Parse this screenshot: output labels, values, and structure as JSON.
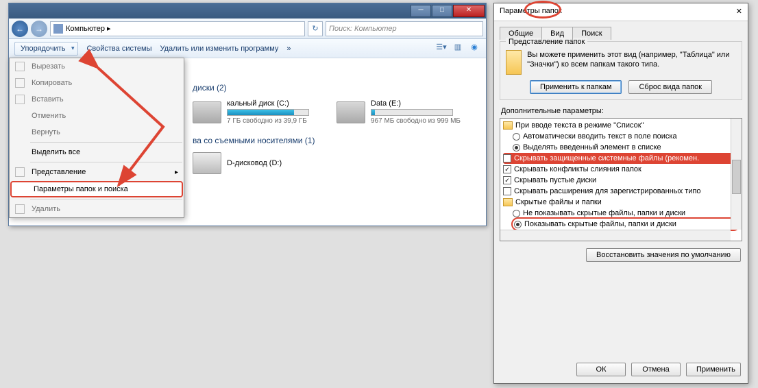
{
  "explorer": {
    "breadcrumb": "Компьютер  ▸",
    "search_placeholder": "Поиск: Компьютер",
    "toolbar": {
      "organize": "Упорядочить",
      "properties": "Свойства системы",
      "uninstall": "Удалить или изменить программу",
      "overflow": "»"
    },
    "menu": {
      "cut": "Вырезать",
      "copy": "Копировать",
      "paste": "Вставить",
      "undo": "Отменить",
      "redo": "Вернуть",
      "select_all": "Выделить все",
      "layout": "Представление",
      "folder_opts": "Параметры папок и поиска",
      "delete": "Удалить"
    },
    "content": {
      "hd_section": "диски (2)",
      "drive_c": {
        "name": "кальный диск (C:)",
        "sub": "7 ГБ свободно из 39,9 ГБ",
        "fill": 82
      },
      "drive_e": {
        "name": "Data (E:)",
        "sub": "967 МБ свободно из 999 МБ",
        "fill": 4
      },
      "removable_section": "ва со съемными носителями (1)",
      "dvd": "D-дисковод (D:)"
    }
  },
  "dialog": {
    "title": "Параметры папок",
    "tabs": {
      "general": "Общие",
      "view": "Вид",
      "search": "Поиск"
    },
    "present": {
      "group": "Представление папок",
      "text": "Вы можете применить этот вид (например, \"Таблица\" или \"Значки\") ко всем папкам такого типа.",
      "apply": "Применить к папкам",
      "reset": "Сброс вида папок"
    },
    "adv_label": "Дополнительные параметры:",
    "tree": {
      "g1": "При вводе текста в режиме \"Список\"",
      "g1a": "Автоматически вводить текст в поле поиска",
      "g1b": "Выделять введенный элемент в списке",
      "hide_sys": "Скрывать защищенные системные файлы (рекомен.",
      "hide_merge": "Скрывать конфликты слияния папок",
      "hide_empty": "Скрывать пустые диски",
      "hide_ext": "Скрывать расширения для зарегистрированных типо",
      "g2": "Скрытые файлы и папки",
      "g2a": "Не показывать скрытые файлы, папки и диски",
      "g2b": "Показывать скрытые файлы, папки и диски"
    },
    "restore": "Восстановить значения по умолчанию",
    "ok": "ОК",
    "cancel": "Отмена",
    "apply_btn": "Применить"
  }
}
